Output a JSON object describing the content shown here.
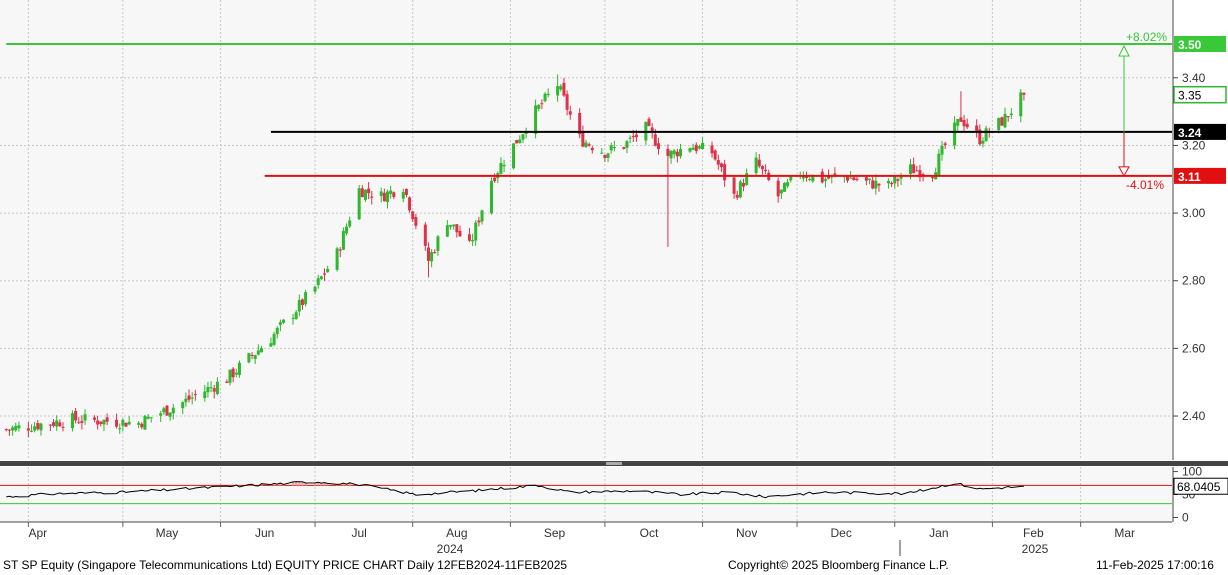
{
  "footer": {
    "description": "ST SP Equity (Singapore Telecommunications Ltd) EQUITY PRICE CHART  Daily 12FEB2024-11FEB2025",
    "copyright": "Copyright© 2025 Bloomberg Finance L.P.",
    "timestamp": "11-Feb-2025 17:00:16"
  },
  "colors": {
    "up": "#2db82d",
    "down": "#e0304a",
    "target_line": "#38c838",
    "resistance_line": "#000000",
    "support_line": "#e01010",
    "rsi_line": "#000000",
    "rsi_overbought_fill": "#f4a0a0"
  },
  "chart_data": [
    {
      "type": "candlestick",
      "ylim": [
        2.27,
        3.63
      ],
      "y_ticks": [
        2.4,
        2.6,
        2.8,
        3.0,
        3.2,
        3.4
      ],
      "y_tick_labels": [
        "2.40",
        "2.60",
        "2.80",
        "3.00",
        "3.20",
        "3.40"
      ],
      "x_month_labels": [
        "Apr",
        "May",
        "Jun",
        "Jul",
        "Aug",
        "Sep",
        "Oct",
        "Nov",
        "Dec",
        "Jan",
        "Feb",
        "Mar"
      ],
      "x_year_labels": [
        "2024",
        "2025"
      ],
      "grid": true,
      "close_path": [
        [
          "2024-03-25",
          2.36
        ],
        [
          "2024-04-15",
          2.39
        ],
        [
          "2024-05-06",
          2.38
        ],
        [
          "2024-05-20",
          2.44
        ],
        [
          "2024-06-03",
          2.51
        ],
        [
          "2024-06-17",
          2.63
        ],
        [
          "2024-07-01",
          2.78
        ],
        [
          "2024-07-08",
          2.88
        ],
        [
          "2024-07-15",
          3.07
        ],
        [
          "2024-07-22",
          3.05
        ],
        [
          "2024-07-29",
          3.08
        ],
        [
          "2024-08-02",
          2.97
        ],
        [
          "2024-08-06",
          2.86
        ],
        [
          "2024-08-12",
          2.98
        ],
        [
          "2024-08-19",
          2.9
        ],
        [
          "2024-08-26",
          3.1
        ],
        [
          "2024-09-02",
          3.2
        ],
        [
          "2024-09-09",
          3.3
        ],
        [
          "2024-09-16",
          3.38
        ],
        [
          "2024-09-23",
          3.22
        ],
        [
          "2024-10-01",
          3.18
        ],
        [
          "2024-10-07",
          3.2
        ],
        [
          "2024-10-14",
          3.25
        ],
        [
          "2024-10-21",
          3.17
        ],
        [
          "2024-10-28",
          3.2
        ],
        [
          "2024-11-04",
          3.18
        ],
        [
          "2024-11-11",
          3.05
        ],
        [
          "2024-11-18",
          3.15
        ],
        [
          "2024-11-25",
          3.05
        ],
        [
          "2024-12-02",
          3.12
        ],
        [
          "2024-12-09",
          3.1
        ],
        [
          "2024-12-16",
          3.11
        ],
        [
          "2024-12-23",
          3.09
        ],
        [
          "2024-12-30",
          3.08
        ],
        [
          "2025-01-06",
          3.13
        ],
        [
          "2025-01-13",
          3.12
        ],
        [
          "2025-01-17",
          3.2
        ],
        [
          "2025-01-22",
          3.28
        ],
        [
          "2025-01-28",
          3.22
        ],
        [
          "2025-02-05",
          3.28
        ],
        [
          "2025-02-11",
          3.35
        ]
      ],
      "wicks": [
        [
          "2024-10-21",
          2.9
        ],
        [
          "2024-08-06",
          2.81
        ],
        [
          "2024-09-16",
          3.41
        ],
        [
          "2025-01-22",
          3.36
        ]
      ],
      "lines": [
        {
          "label": "3.50",
          "value": 3.5,
          "color": "#38c838",
          "start": "2024-03-25"
        },
        {
          "label": "3.24",
          "value": 3.24,
          "color": "#000000",
          "start": "2024-06-17"
        },
        {
          "label": "3.11",
          "value": 3.11,
          "color": "#e01010",
          "start": "2024-06-15"
        }
      ],
      "last_price_label": "3.35",
      "last_price": 3.35,
      "annotations": [
        {
          "text": "+8.02%",
          "color": "#38c838"
        },
        {
          "text": "-4.01%",
          "color": "#e01010"
        }
      ]
    },
    {
      "type": "line",
      "series": [
        {
          "values_path": [
            [
              "2024-03-25",
              45
            ],
            [
              "2024-04-10",
              52
            ],
            [
              "2024-05-01",
              55
            ],
            [
              "2024-05-20",
              62
            ],
            [
              "2024-06-10",
              70
            ],
            [
              "2024-07-01",
              78
            ],
            [
              "2024-07-15",
              72
            ],
            [
              "2024-08-02",
              50
            ],
            [
              "2024-08-20",
              58
            ],
            [
              "2024-09-10",
              70
            ],
            [
              "2024-09-20",
              55
            ],
            [
              "2024-10-10",
              58
            ],
            [
              "2024-10-25",
              50
            ],
            [
              "2024-11-10",
              55
            ],
            [
              "2024-11-20",
              45
            ],
            [
              "2024-12-10",
              55
            ],
            [
              "2025-01-05",
              52
            ],
            [
              "2025-01-20",
              75
            ],
            [
              "2025-01-28",
              62
            ],
            [
              "2025-02-11",
              68
            ]
          ]
        }
      ],
      "ylim": [
        -10,
        110
      ],
      "y_ticks": [
        0,
        50,
        100
      ],
      "y_tick_labels": [
        "0",
        "50",
        "100"
      ],
      "overbought": 70,
      "oversold": 30,
      "last_value_label": "68.0405",
      "last_value": 68.0405
    }
  ]
}
